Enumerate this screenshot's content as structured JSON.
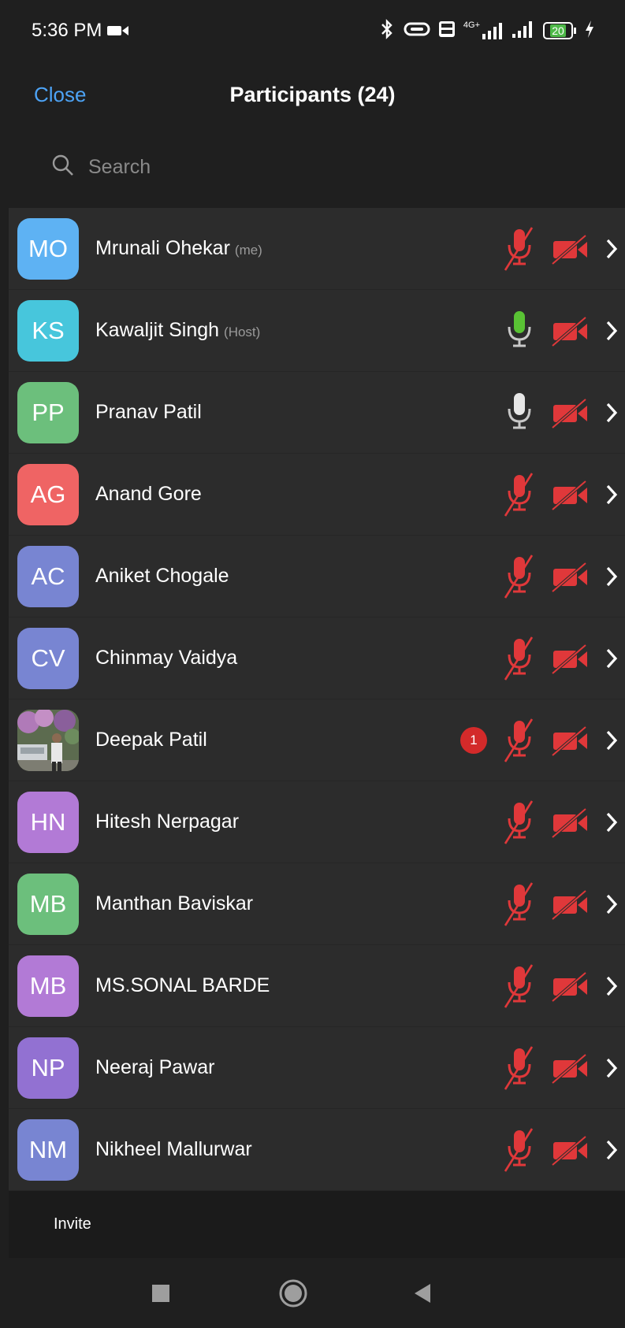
{
  "status_bar": {
    "time": "5:36 PM",
    "battery": "20",
    "network": "4G+"
  },
  "header": {
    "close_label": "Close",
    "title": "Participants (24)"
  },
  "search": {
    "placeholder": "Search"
  },
  "participants": [
    {
      "initials": "MO",
      "name": "Mrunali Ohekar",
      "tag": "(me)",
      "color": "#5eb2f3",
      "mic": "muted",
      "video": "off"
    },
    {
      "initials": "KS",
      "name": "Kawaljit Singh",
      "tag": "(Host)",
      "color": "#47c6dc",
      "mic": "active",
      "video": "off"
    },
    {
      "initials": "PP",
      "name": "Pranav Patil",
      "tag": "",
      "color": "#6cbf7c",
      "mic": "on",
      "video": "off"
    },
    {
      "initials": "AG",
      "name": "Anand Gore",
      "tag": "",
      "color": "#ef6464",
      "mic": "muted",
      "video": "off"
    },
    {
      "initials": "AC",
      "name": "Aniket Chogale",
      "tag": "",
      "color": "#7885d2",
      "mic": "muted",
      "video": "off"
    },
    {
      "initials": "CV",
      "name": "Chinmay Vaidya",
      "tag": "",
      "color": "#7885d2",
      "mic": "muted",
      "video": "off"
    },
    {
      "initials": "",
      "name": "Deepak Patil",
      "tag": "",
      "color": "#6a7a5a",
      "mic": "muted",
      "video": "off",
      "photo": true,
      "badge": "1"
    },
    {
      "initials": "HN",
      "name": "Hitesh Nerpagar",
      "tag": "",
      "color": "#b27ad6",
      "mic": "muted",
      "video": "off"
    },
    {
      "initials": "MB",
      "name": "Manthan Baviskar",
      "tag": "",
      "color": "#6cbf7c",
      "mic": "muted",
      "video": "off"
    },
    {
      "initials": "MB",
      "name": "MS.SONAL BARDE",
      "tag": "",
      "color": "#b27ad6",
      "mic": "muted",
      "video": "off"
    },
    {
      "initials": "NP",
      "name": "Neeraj Pawar",
      "tag": "",
      "color": "#9271d2",
      "mic": "muted",
      "video": "off"
    },
    {
      "initials": "NM",
      "name": "Nikheel Mallurwar",
      "tag": "",
      "color": "#7885d2",
      "mic": "muted",
      "video": "off"
    }
  ],
  "footer": {
    "invite_label": "Invite"
  },
  "colors": {
    "accent": "#4da3f5",
    "muted_red": "#e0383a",
    "active_green": "#59c234"
  }
}
